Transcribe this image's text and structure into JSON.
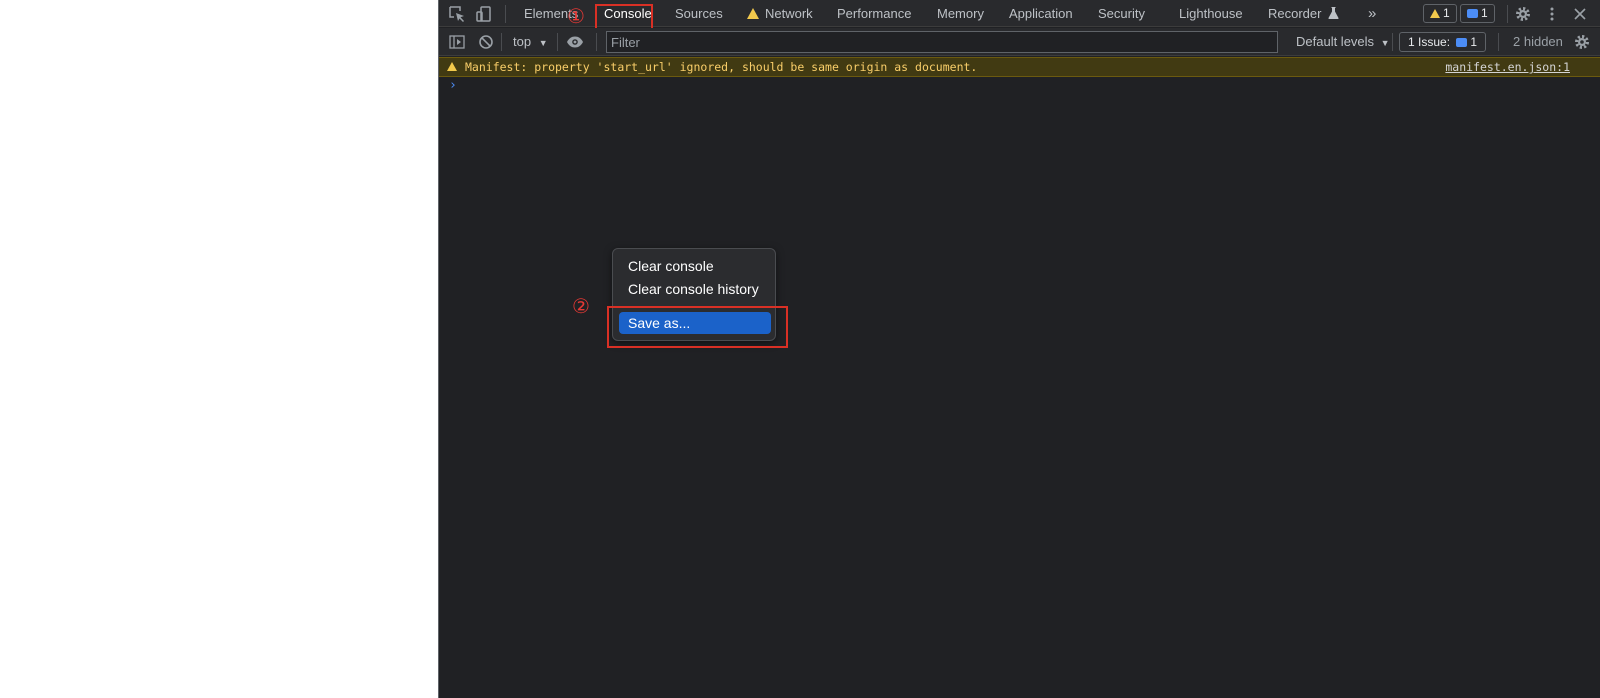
{
  "tabs": [
    "Elements",
    "Console",
    "Sources",
    "Network",
    "Performance",
    "Memory",
    "Application",
    "Security",
    "Lighthouse",
    "Recorder"
  ],
  "more_tabs": "»",
  "badges": {
    "warnings": "1",
    "messages": "1"
  },
  "annotations": {
    "step1": "①",
    "step2": "②"
  },
  "toolbar": {
    "context": "top",
    "filter_placeholder": "Filter",
    "levels": "Default levels",
    "issues_label": "1 Issue:",
    "issues_count": "1",
    "hidden": "2 hidden"
  },
  "console": {
    "warning": {
      "text": "Manifest: property 'start_url' ignored, should be same origin as document.",
      "source": "manifest.en.json:1"
    },
    "prompt": "›"
  },
  "context_menu": {
    "items": [
      "Clear console",
      "Clear console history",
      "Save as..."
    ],
    "highlighted": "Save as..."
  },
  "colors": {
    "background": "#202124",
    "toolbar": "#292a2d",
    "warning_bg": "#413a12",
    "warning_text": "#f9ce69",
    "accent": "#1b62c9",
    "annotation": "#d93025"
  },
  "icons": [
    "inspect-element-icon",
    "device-toggle-icon",
    "sidebar-toggle-icon",
    "clear-console-icon",
    "eye-icon",
    "settings-gear-icon",
    "more-vertical-icon",
    "close-icon",
    "warning-icon",
    "message-icon",
    "flask-icon"
  ]
}
